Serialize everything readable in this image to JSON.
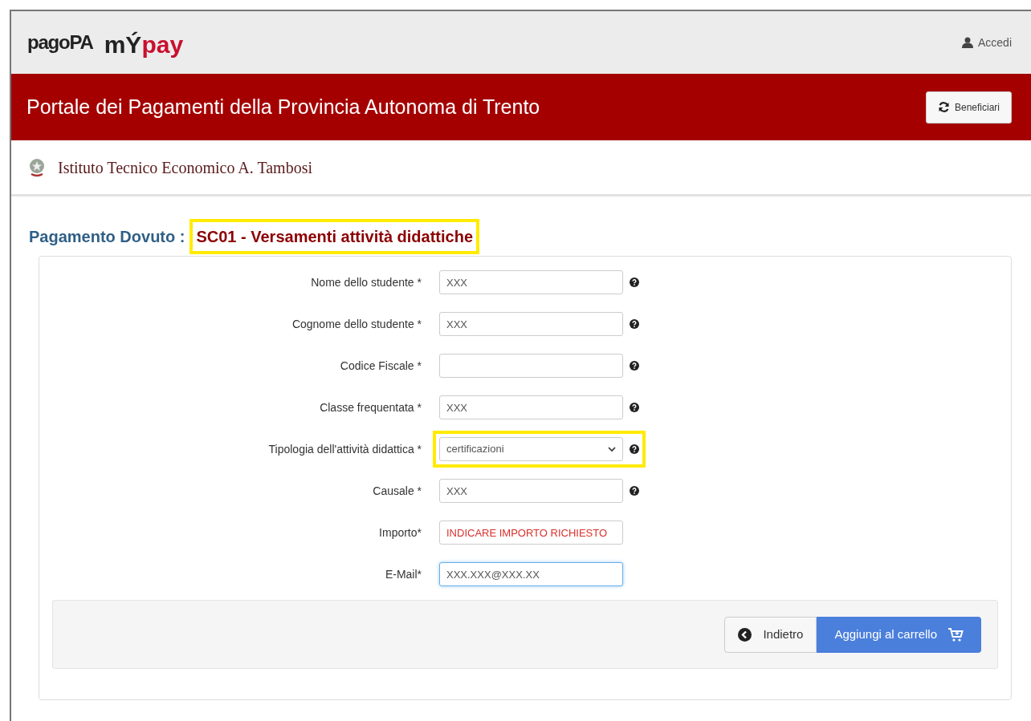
{
  "header": {
    "logo_primary": "pagoPA",
    "logo_secondary_dark": "mÝ",
    "logo_secondary_red": "pay",
    "login": "Accedi"
  },
  "banner": {
    "title": "Portale dei Pagamenti della Provincia Autonoma di Trento",
    "button": "Beneficiari"
  },
  "institution": {
    "name": "Istituto Tecnico Economico A. Tambosi"
  },
  "page_title": {
    "label": "Pagamento Dovuto :",
    "code": "SC01 - Versamenti attività didattiche",
    "highlighted": true
  },
  "fields": [
    {
      "kind": "text",
      "label": "Nome dello studente *",
      "value": "XXX",
      "color": "#555555",
      "help": true,
      "focused": false,
      "highlighted": false
    },
    {
      "kind": "text",
      "label": "Cognome dello studente *",
      "value": "XXX",
      "color": "#555555",
      "help": true,
      "focused": false,
      "highlighted": false
    },
    {
      "kind": "text",
      "label": "Codice Fiscale *",
      "help": true,
      "focused": false,
      "highlighted": false
    },
    {
      "kind": "text",
      "label": "Classe frequentata *",
      "value": "XXX",
      "color": "#555555",
      "help": true,
      "focused": false,
      "highlighted": false
    },
    {
      "kind": "select",
      "label": "Tipologia dell'attività didattica *",
      "value": "certificazioni",
      "color": "#555555",
      "help": true,
      "focused": false,
      "highlighted": true
    },
    {
      "kind": "text",
      "label": "Causale *",
      "value": "XXX",
      "color": "#555555",
      "help": true,
      "focused": false,
      "highlighted": false
    },
    {
      "kind": "text",
      "label": "Importo*",
      "value": "INDICARE IMPORTO RICHIESTO",
      "color": "#d9302c",
      "help": false,
      "focused": false,
      "highlighted": false
    },
    {
      "kind": "text",
      "label": "E-Mail*",
      "value": "XXX.XXX@XXX.XX",
      "color": "#555555",
      "help": false,
      "focused": true,
      "highlighted": false
    }
  ],
  "actions": {
    "back": "Indietro",
    "add": "Aggiungi al carrello"
  }
}
